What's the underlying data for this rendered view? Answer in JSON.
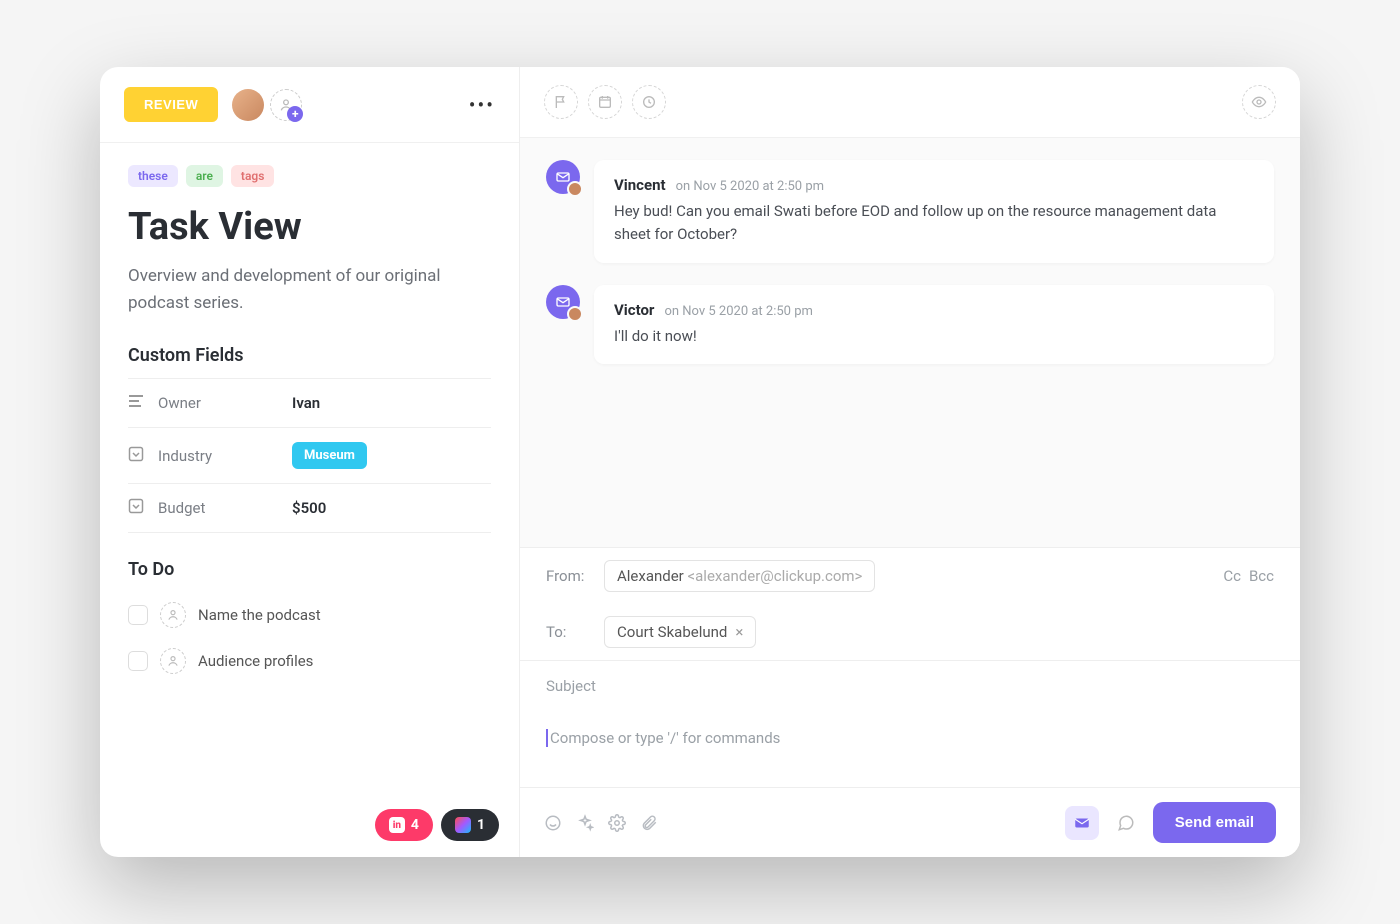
{
  "left": {
    "status_label": "REVIEW",
    "tags": [
      "these",
      "are",
      "tags"
    ],
    "title": "Task View",
    "description": "Overview and development of our original podcast series.",
    "custom_fields_label": "Custom Fields",
    "custom_fields": [
      {
        "icon": "lines",
        "label": "Owner",
        "value": "Ivan",
        "type": "text"
      },
      {
        "icon": "dropdown",
        "label": "Industry",
        "value": "Museum",
        "type": "chip"
      },
      {
        "icon": "dropdown",
        "label": "Budget",
        "value": "$500",
        "type": "text"
      }
    ],
    "todo_label": "To Do",
    "todos": [
      {
        "label": "Name the podcast"
      },
      {
        "label": "Audience profiles"
      }
    ],
    "badges": {
      "invision_count": "4",
      "figma_count": "1"
    }
  },
  "right": {
    "messages": [
      {
        "author": "Vincent",
        "timestamp": "on Nov 5 2020 at 2:50 pm",
        "body": "Hey bud! Can you email Swati before EOD and follow up on the resource management data sheet for October?"
      },
      {
        "author": "Victor",
        "timestamp": "on Nov 5 2020 at 2:50 pm",
        "body": "I'll do it now!"
      }
    ],
    "composer": {
      "from_label": "From:",
      "from_name": "Alexander",
      "from_email": "<alexander@clickup.com>",
      "to_label": "To:",
      "to_chip": "Court Skabelund",
      "cc_label": "Cc",
      "bcc_label": "Bcc",
      "subject_placeholder": "Subject",
      "body_placeholder": "Compose or type '/' for commands",
      "send_label": "Send email"
    }
  }
}
